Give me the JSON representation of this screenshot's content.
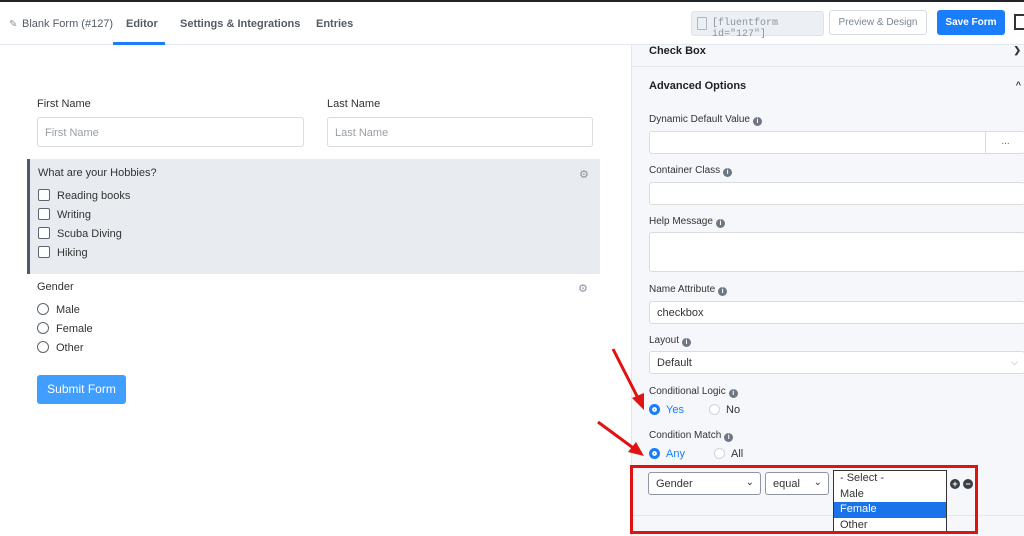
{
  "header": {
    "form_title": "Blank Form (#127)",
    "tabs": [
      "Editor",
      "Settings & Integrations",
      "Entries"
    ],
    "active_tab": "Editor",
    "shortcode": "[fluentform id=\"127\"]",
    "preview_label": "Preview & Design",
    "save_label": "Save Form"
  },
  "form": {
    "first_name_label": "First Name",
    "first_name_placeholder": "First Name",
    "last_name_label": "Last Name",
    "last_name_placeholder": "Last Name",
    "hobbies_question": "What are your Hobbies?",
    "hobbies": [
      "Reading books",
      "Writing",
      "Scuba Diving",
      "Hiking"
    ],
    "gender_label": "Gender",
    "gender_options": [
      "Male",
      "Female",
      "Other"
    ],
    "submit_label": "Submit Form"
  },
  "panel": {
    "checkbox_section": "Check Box",
    "advanced_section": "Advanced Options",
    "dynamic_default_label": "Dynamic Default Value",
    "dots_label": "...",
    "container_class_label": "Container Class",
    "help_message_label": "Help Message",
    "name_attribute_label": "Name Attribute",
    "name_attribute_value": "checkbox",
    "layout_label": "Layout",
    "layout_value": "Default",
    "conditional_logic_label": "Conditional Logic",
    "conditional_yes": "Yes",
    "conditional_no": "No",
    "condition_match_label": "Condition Match",
    "match_any": "Any",
    "match_all": "All",
    "condition_field": "Gender",
    "condition_operator": "equal",
    "value_options": [
      "- Select -",
      "Male",
      "Female",
      "Other"
    ],
    "value_highlighted": "Female"
  },
  "colors": {
    "accent": "#1a7efb",
    "annotation_red": "#e01212"
  }
}
